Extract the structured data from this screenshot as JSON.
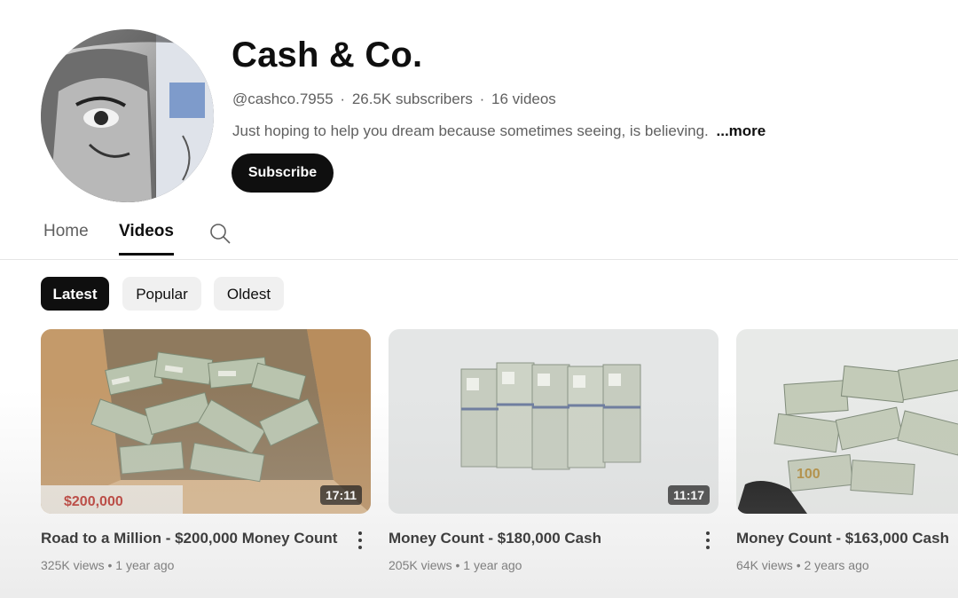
{
  "channel": {
    "name": "Cash & Co.",
    "handle": "@cashco.7955",
    "subscribers": "26.5K subscribers",
    "video_count": "16 videos",
    "separator": "·",
    "description": "Just hoping to help you dream because sometimes seeing, is believing.",
    "more_label": "...more",
    "subscribe_label": "Subscribe",
    "avatar_icon": "banknote-portrait-avatar"
  },
  "tabs": [
    {
      "label": "Home",
      "active": false
    },
    {
      "label": "Videos",
      "active": true
    }
  ],
  "search_icon": "search-icon",
  "chips": [
    {
      "label": "Latest",
      "active": true
    },
    {
      "label": "Popular",
      "active": false
    },
    {
      "label": "Oldest",
      "active": false
    }
  ],
  "videos": [
    {
      "title": "Road to a Million - $200,000 Money Count",
      "views": "325K views",
      "age": "1 year ago",
      "duration": "17:11",
      "thumb_label": "$200,000",
      "has_menu": true
    },
    {
      "title": "Money Count - $180,000 Cash",
      "views": "205K views",
      "age": "1 year ago",
      "duration": "11:17",
      "has_menu": true
    },
    {
      "title": "Money Count - $163,000 Cash",
      "views": "64K views",
      "age": "2 years ago",
      "has_menu": false
    }
  ],
  "meta_bullet": "•",
  "colors": {
    "primary_text": "#0f0f0f",
    "secondary_text": "#606060",
    "chip_bg": "#f0f0f0",
    "button_bg": "#0f0f0f",
    "money_green": "#a9b8a0",
    "box_cardboard": "#c9a37a",
    "price_red": "#b8322a"
  }
}
